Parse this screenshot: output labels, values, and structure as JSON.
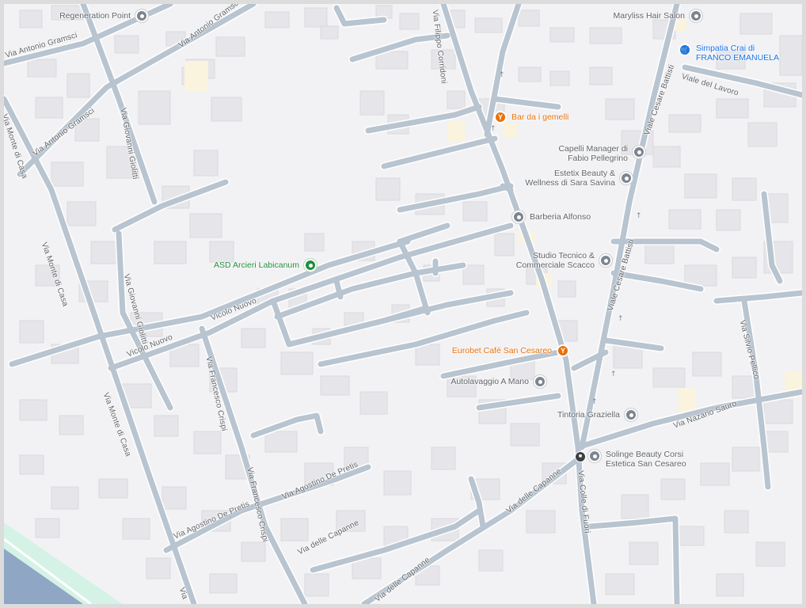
{
  "colors": {
    "background": "#f2f2f4",
    "road": "#b8c4d0",
    "building": "#e6e6ea",
    "park": "#d4f3e6",
    "river": "#8fa6c4",
    "poi_generic": "#7d8590",
    "poi_food": "#e8710a",
    "poi_sport": "#1e8e3e",
    "poi_shopping": "#1a73e8"
  },
  "pois": [
    {
      "label": "Regeneration Point",
      "category": "generic",
      "icon": "pin-icon"
    },
    {
      "label": "Maryliss Hair Salon",
      "category": "generic",
      "icon": "pin-icon"
    },
    {
      "label": "Simpatia Crai di\nFRANCO EMANUELA",
      "category": "shopping",
      "icon": "shopping-cart-icon"
    },
    {
      "label": "Bar da i gemelli",
      "category": "food",
      "icon": "cocktail-icon"
    },
    {
      "label": "Capelli Manager di\nFabio Pellegrino",
      "category": "generic",
      "icon": "pin-icon"
    },
    {
      "label": "Estetix Beauty &\nWellness di Sara Savina",
      "category": "generic",
      "icon": "pin-icon"
    },
    {
      "label": "Barberia Alfonso",
      "category": "generic",
      "icon": "pin-icon"
    },
    {
      "label": "ASD Arcieri Labicanum",
      "category": "sport",
      "icon": "pin-icon"
    },
    {
      "label": "Studio Tecnico &\nCommerciale Scacco",
      "category": "generic",
      "icon": "pin-icon"
    },
    {
      "label": "Eurobet Café San Cesareo",
      "category": "food",
      "icon": "cocktail-icon"
    },
    {
      "label": "Autolavaggio A Mano",
      "category": "generic",
      "icon": "pin-icon"
    },
    {
      "label": "Tintoria Graziella",
      "category": "generic",
      "icon": "pin-icon"
    },
    {
      "label": "Solinge Beauty Corsi\nEstetica San Cesareo",
      "category": "generic",
      "icon": "pin-icon"
    }
  ],
  "streets": [
    "Via Antonio Gramsci",
    "Via Antonio Gramsci",
    "Via Antonio Gramsci",
    "Via Filippo Corridoni",
    "Viale del Lavoro",
    "Viale Cesare Battisti",
    "Viale Cesare Battisti",
    "Via Monte di Casa",
    "Via Monte di Casa",
    "Via Monte di Casa",
    "Via Giovanni Giolitti",
    "Via Giovanni Giolitti",
    "Vicolo Nuovo",
    "Vicolo Nuovo",
    "Via Francesco Crispi",
    "Via Francesco Crispi",
    "Via Agostino De Pretis",
    "Via Agostino De Pretis",
    "Via delle Capanne",
    "Via delle Capanne",
    "Via delle Capanne",
    "Via Colle di Fuori",
    "Via Nazario Sauro",
    "Via Silvio Pellico",
    "Via"
  ],
  "transit": {
    "icon": "bus-stop-icon"
  }
}
